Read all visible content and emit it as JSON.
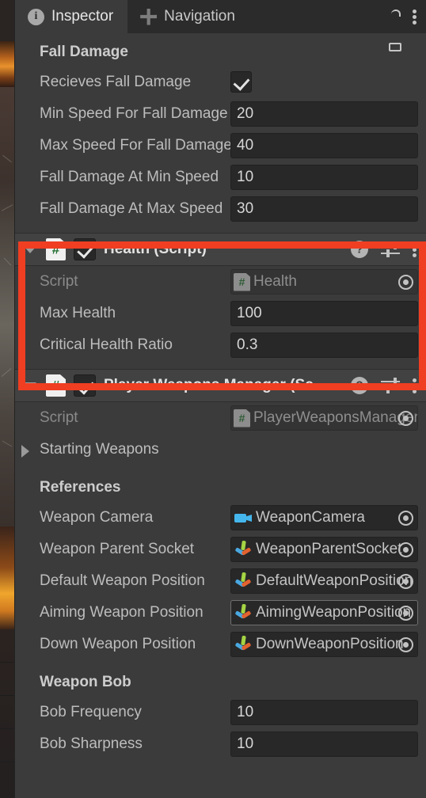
{
  "window": {
    "tabs": [
      {
        "label": "Inspector",
        "icon": "info-icon",
        "active": true
      },
      {
        "label": "Navigation",
        "icon": "navigation-move-icon",
        "active": false
      }
    ],
    "lock_icon": "lock-open-icon",
    "menu_icon": "kebab-menu-icon"
  },
  "fall_damage": {
    "header": "Fall Damage",
    "rows": [
      {
        "label": "Recieves Fall Damage",
        "type": "checkbox",
        "value": true
      },
      {
        "label": "Min Speed For Fall Damage",
        "type": "number",
        "value": "20"
      },
      {
        "label": "Max Speed For Fall Damage",
        "type": "number",
        "value": "40"
      },
      {
        "label": "Fall Damage At Min Speed",
        "type": "number",
        "value": "10"
      },
      {
        "label": "Fall Damage At Max Speed",
        "type": "number",
        "value": "30"
      }
    ]
  },
  "health_component": {
    "title": "Health (Script)",
    "enabled": true,
    "expanded": true,
    "script_icon": "csharp-script-icon",
    "help_icon": "help-icon",
    "preset_icon": "preset-settings-icon",
    "menu_icon": "kebab-menu-icon",
    "highlighted": true,
    "highlight_color": "#f03e22",
    "rows": [
      {
        "label": "Script",
        "type": "object",
        "value": "Health",
        "icon": "csharp-script-icon",
        "disabled": true
      },
      {
        "label": "Max Health",
        "type": "number",
        "value": "100"
      },
      {
        "label": "Critical Health Ratio",
        "type": "number",
        "value": "0.3"
      }
    ]
  },
  "weapons_component": {
    "title": "Player Weapons Manager (Script)",
    "enabled": true,
    "expanded": true,
    "script_icon": "csharp-script-icon",
    "help_icon": "help-icon",
    "preset_icon": "preset-settings-icon",
    "menu_icon": "kebab-menu-icon",
    "script_row": {
      "label": "Script",
      "value": "PlayerWeaponsManager",
      "icon": "csharp-script-icon",
      "disabled": true
    },
    "starting_weapons": {
      "label": "Starting Weapons",
      "expanded": false
    },
    "references": {
      "header": "References",
      "rows": [
        {
          "label": "Weapon Camera",
          "value": "WeaponCamera",
          "icon": "camera-icon",
          "hovered": false
        },
        {
          "label": "Weapon Parent Socket",
          "value": "WeaponParentSocket",
          "icon": "transform-icon",
          "hovered": false
        },
        {
          "label": "Default Weapon Position",
          "value": "DefaultWeaponPosition",
          "icon": "transform-icon",
          "hovered": false
        },
        {
          "label": "Aiming Weapon Position",
          "value": "AimingWeaponPosition",
          "icon": "transform-icon",
          "hovered": true
        },
        {
          "label": "Down Weapon Position",
          "value": "DownWeaponPosition",
          "icon": "transform-icon",
          "hovered": false
        }
      ]
    },
    "weapon_bob": {
      "header": "Weapon Bob",
      "rows": [
        {
          "label": "Bob Frequency",
          "value": "10"
        },
        {
          "label": "Bob Sharpness",
          "value": "10"
        }
      ]
    }
  },
  "colors": {
    "panel_bg": "#3b3b3b",
    "header_bg": "#424242",
    "field_bg": "#282828",
    "tabbar_bg": "#2b2b2b",
    "text": "#bdbdbd",
    "highlight": "#f03e22"
  }
}
